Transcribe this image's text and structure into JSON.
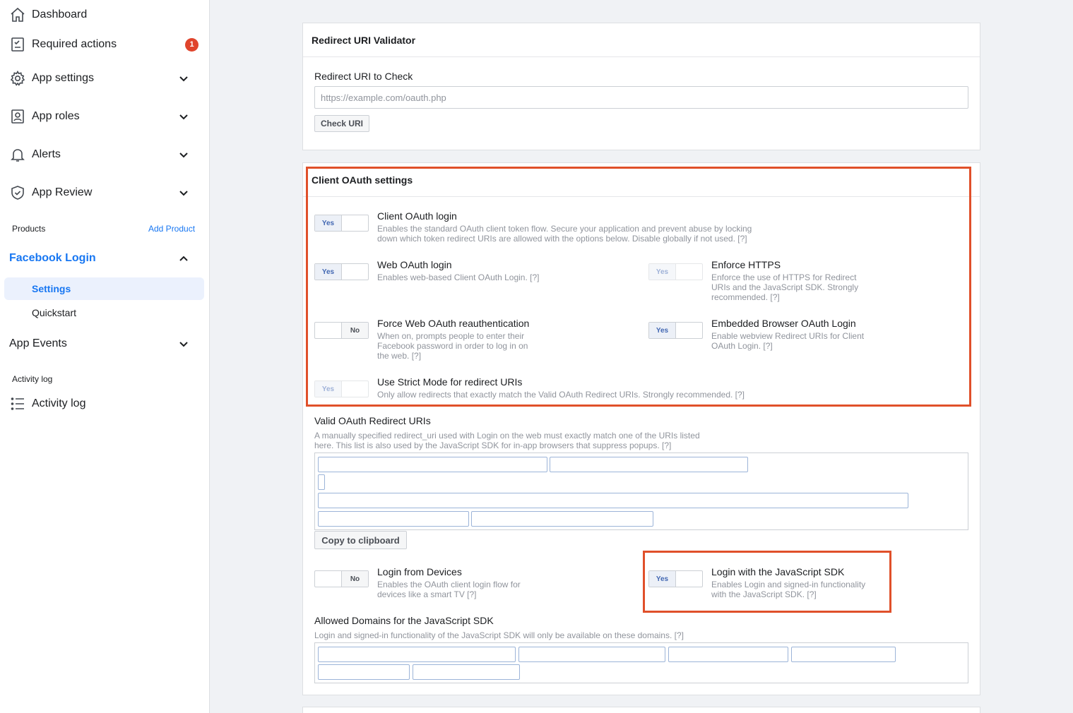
{
  "sidebar": {
    "items": [
      {
        "label": "Dashboard",
        "icon": "home-icon"
      },
      {
        "label": "Required actions",
        "icon": "checklist-icon",
        "badge": "1"
      },
      {
        "label": "App settings",
        "icon": "gear-icon"
      },
      {
        "label": "App roles",
        "icon": "user-badge-icon"
      },
      {
        "label": "Alerts",
        "icon": "bell-icon"
      },
      {
        "label": "App Review",
        "icon": "shield-check-icon"
      }
    ],
    "products_label": "Products",
    "add_product": "Add Product",
    "facebook_login": "Facebook Login",
    "settings": "Settings",
    "quickstart": "Quickstart",
    "app_events": "App Events",
    "activity_section": "Activity log",
    "activity_log": "Activity log"
  },
  "validator": {
    "title": "Redirect URI Validator",
    "field_label": "Redirect URI to Check",
    "placeholder": "https://example.com/oauth.php",
    "button": "Check URI"
  },
  "oauth": {
    "title": "Client OAuth settings",
    "client_login": {
      "title": "Client OAuth login",
      "desc1": "Enables the standard OAuth client token flow. Secure your application and prevent abuse by locking",
      "desc2": "down which token redirect URIs are allowed with the options below. Disable globally if not used.  [?]",
      "state": "Yes"
    },
    "web_login": {
      "title": "Web OAuth login",
      "desc1": "Enables web-based Client OAuth Login. [?]",
      "state": "Yes"
    },
    "enforce_https": {
      "title": "Enforce HTTPS",
      "desc1": "Enforce the use of HTTPS for Redirect",
      "desc2": "URIs and the JavaScript SDK. Strongly",
      "desc3": "recommended.  [?]",
      "state": "Yes"
    },
    "force_reauth": {
      "title": "Force Web OAuth reauthentication",
      "desc1": "When on, prompts people to enter their",
      "desc2": "Facebook password in order to log in on",
      "desc3": "the web.  [?]",
      "state": "No"
    },
    "embedded_browser": {
      "title": "Embedded Browser OAuth Login",
      "desc1": "Enable webview Redirect URIs for Client",
      "desc2": "OAuth Login.  [?]",
      "state": "Yes"
    },
    "strict_mode": {
      "title": "Use Strict Mode for redirect URIs",
      "desc1": "Only allow redirects that exactly match the Valid OAuth Redirect URIs. Strongly recommended.   [?]",
      "state": "Yes"
    },
    "valid_uris": {
      "title": "Valid OAuth Redirect URIs",
      "desc1": "A manually specified redirect_uri used with Login on the web must exactly match one of the URIs listed",
      "desc2": "here. This list is also used by the JavaScript SDK for in-app browsers that suppress popups.   [?]"
    },
    "copy_button": "Copy to clipboard",
    "login_devices": {
      "title": "Login from Devices",
      "desc1": "Enables the OAuth client login flow for",
      "desc2": "devices like a smart TV  [?]",
      "state": "No"
    },
    "login_js_sdk": {
      "title": "Login with the JavaScript SDK",
      "desc1": "Enables Login and signed-in functionality",
      "desc2": "with the JavaScript SDK.  [?]",
      "state": "Yes"
    },
    "allowed_domains": {
      "title": "Allowed Domains for the JavaScript SDK",
      "desc1": "Login and signed-in functionality of the JavaScript SDK will only be available on these domains.  [?]"
    }
  },
  "colors": {
    "accent": "#1877f2",
    "highlight": "#e0502a",
    "badge": "#e0442c"
  }
}
